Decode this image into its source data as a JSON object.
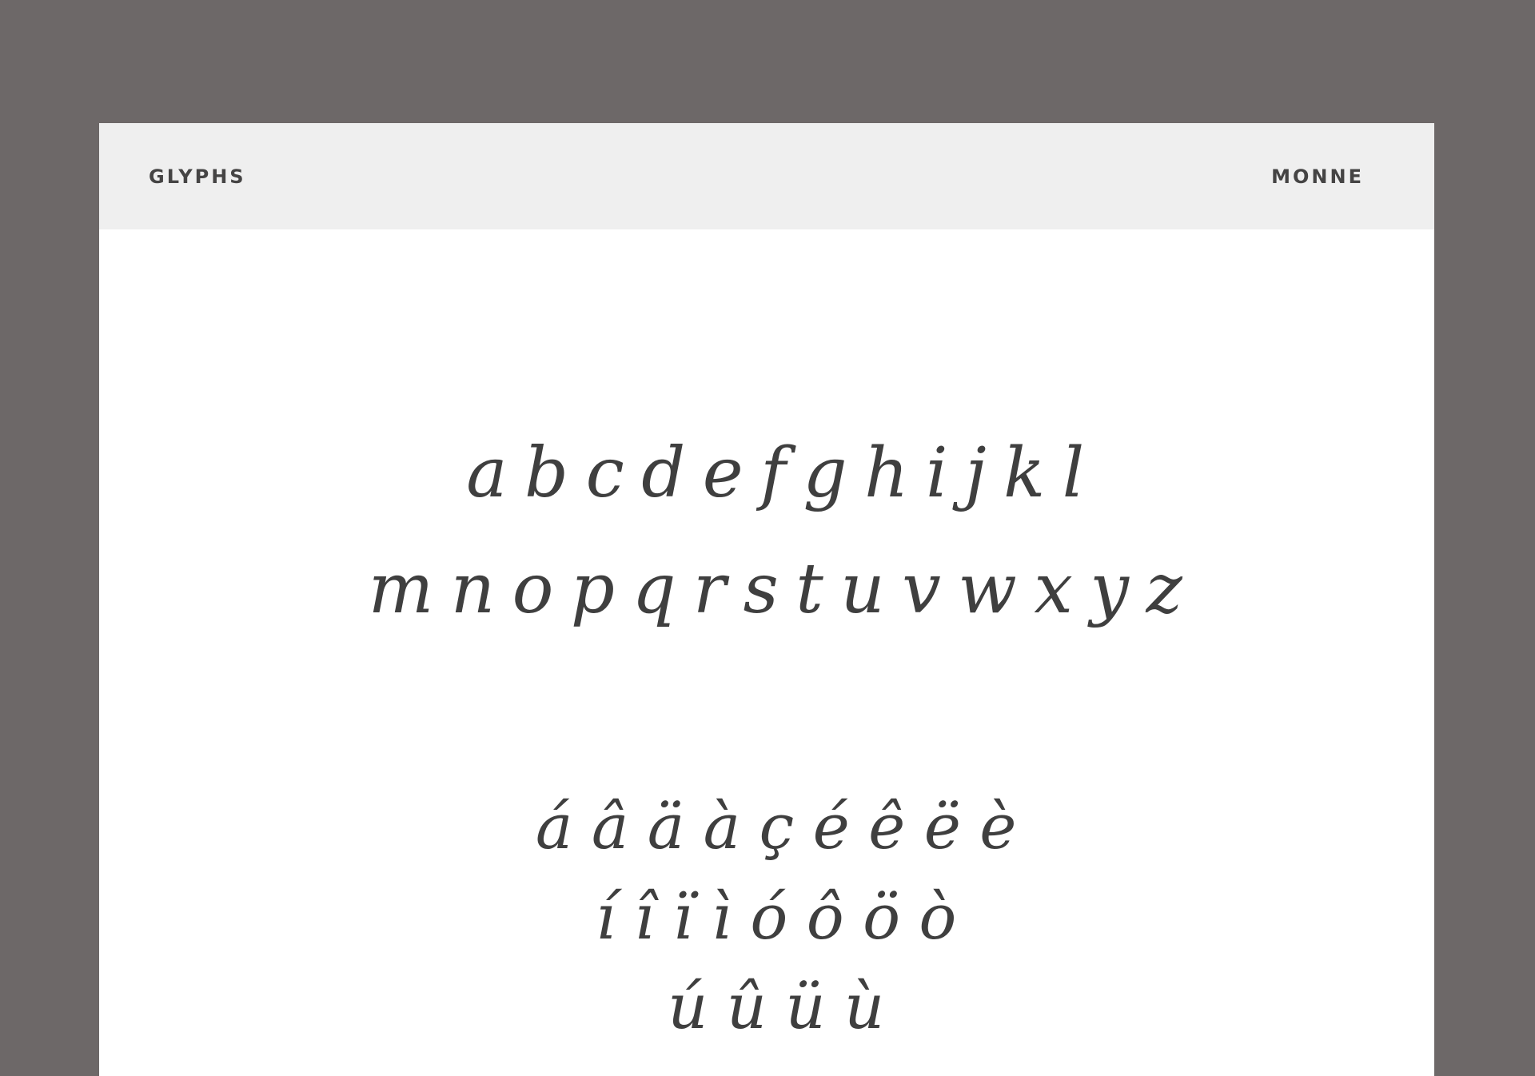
{
  "header": {
    "left_label": "GLYPHS",
    "right_label": "MONNE"
  },
  "glyphs": {
    "lowercase_row_1": "abcdefghijkl",
    "lowercase_row_2": "mnopqrstuvwxyz",
    "accented_row_1": "áâäàçéêëè",
    "accented_row_2": "íîïìóôöò",
    "accented_row_3": "úûüù"
  },
  "colors": {
    "background": "#6d6868",
    "sheet": "#ffffff",
    "header_bar": "#efefef",
    "text": "#3f3f3f"
  }
}
